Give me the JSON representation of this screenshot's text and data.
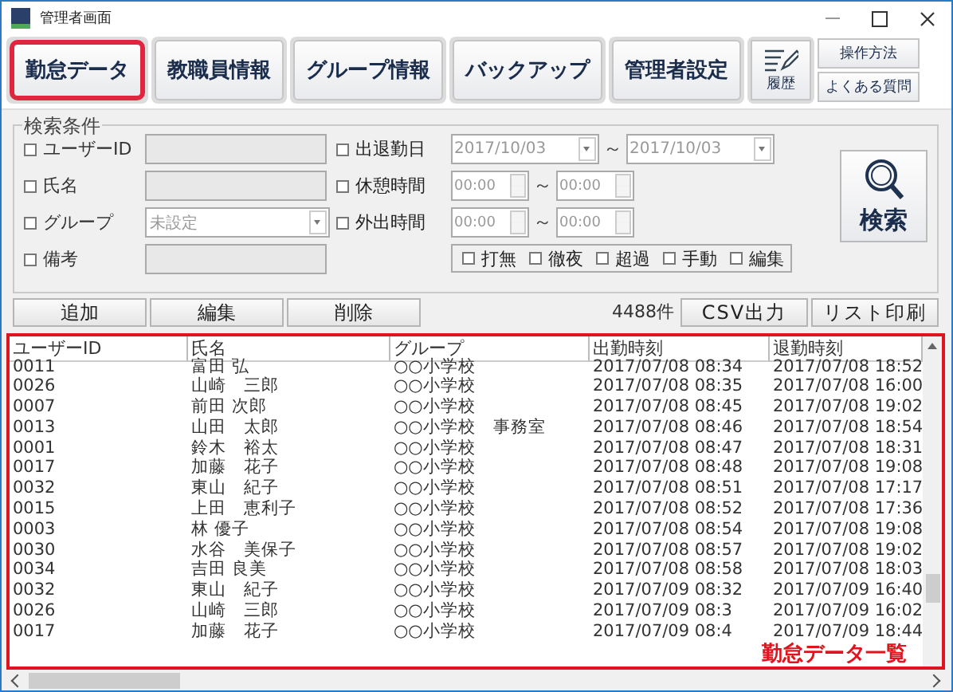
{
  "window": {
    "title": "管理者画面"
  },
  "nav_tabs": [
    {
      "label": "勤怠データ",
      "selected": true
    },
    {
      "label": "教職員情報",
      "selected": false
    },
    {
      "label": "グループ情報",
      "selected": false
    },
    {
      "label": "バックアップ",
      "selected": false
    },
    {
      "label": "管理者設定",
      "selected": false
    }
  ],
  "history_button": {
    "label": "履歴"
  },
  "help_buttons": [
    "操作方法",
    "よくある質問"
  ],
  "search": {
    "legend": "検索条件",
    "fields": [
      {
        "label": "ユーザーID",
        "checked": false,
        "kind": "text"
      },
      {
        "label": "氏名",
        "checked": false,
        "kind": "text"
      },
      {
        "label": "グループ",
        "checked": false,
        "kind": "select",
        "value": "未設定"
      },
      {
        "label": "備考",
        "checked": false,
        "kind": "text"
      }
    ],
    "ranges": [
      {
        "label": "出退勤日",
        "checked": false,
        "kind": "date",
        "from": "2017/10/03",
        "separator": "～",
        "to": "2017/10/03"
      },
      {
        "label": "休憩時間",
        "checked": false,
        "kind": "time",
        "from": "00:00",
        "separator": "～",
        "to": "00:00"
      },
      {
        "label": "外出時間",
        "checked": false,
        "kind": "time",
        "from": "00:00",
        "separator": "～",
        "to": "00:00"
      }
    ],
    "flags": [
      {
        "label": "打無",
        "checked": false
      },
      {
        "label": "徹夜",
        "checked": false
      },
      {
        "label": "超過",
        "checked": false
      },
      {
        "label": "手動",
        "checked": false
      },
      {
        "label": "編集",
        "checked": false
      }
    ],
    "button": "検索"
  },
  "actions": [
    "追加",
    "編集",
    "削除"
  ],
  "count": "4488件",
  "exports": [
    "CSV出力",
    "リスト印刷"
  ],
  "table": {
    "columns": [
      "ユーザーID",
      "氏名",
      "グループ",
      "出勤時刻",
      "退勤時刻"
    ],
    "rows": [
      [
        "0011",
        "富田 弘",
        "○○小学校",
        "2017/07/08 08:34",
        "2017/07/08 18:52"
      ],
      [
        "0026",
        "山崎　三郎",
        "○○小学校",
        "2017/07/08 08:35",
        "2017/07/08 16:00"
      ],
      [
        "0007",
        "前田 次郎",
        "○○小学校",
        "2017/07/08 08:45",
        "2017/07/08 19:02"
      ],
      [
        "0013",
        "山田　太郎",
        "○○小学校　事務室",
        "2017/07/08 08:46",
        "2017/07/08 18:54"
      ],
      [
        "0001",
        "鈴木　裕太",
        "○○小学校",
        "2017/07/08 08:47",
        "2017/07/08 18:31"
      ],
      [
        "0017",
        "加藤　花子",
        "○○小学校",
        "2017/07/08 08:48",
        "2017/07/08 19:08"
      ],
      [
        "0032",
        "東山　紀子",
        "○○小学校",
        "2017/07/08 08:51",
        "2017/07/08 17:17"
      ],
      [
        "0015",
        "上田　恵利子",
        "○○小学校",
        "2017/07/08 08:52",
        "2017/07/08 17:36"
      ],
      [
        "0003",
        "林 優子",
        "○○小学校",
        "2017/07/08 08:54",
        "2017/07/08 19:08"
      ],
      [
        "0030",
        "水谷　美保子",
        "○○小学校",
        "2017/07/08 08:57",
        "2017/07/08 19:02"
      ],
      [
        "0034",
        "吉田 良美",
        "○○小学校",
        "2017/07/08 08:58",
        "2017/07/08 18:03"
      ],
      [
        "0032",
        "東山　紀子",
        "○○小学校",
        "2017/07/09 08:32",
        "2017/07/09 16:40"
      ],
      [
        "0026",
        "山崎　三郎",
        "○○小学校",
        "2017/07/09 08:3",
        "2017/07/09 16:02"
      ],
      [
        "0017",
        "加藤　花子",
        "○○小学校",
        "2017/07/09 08:4",
        "2017/07/09 18:44"
      ]
    ]
  },
  "annotation": "勤怠データ一覧"
}
